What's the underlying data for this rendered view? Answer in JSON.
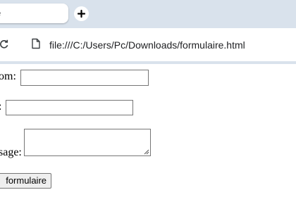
{
  "browser": {
    "tab": {
      "title": "e"
    },
    "new_tab_icon": "plus-icon",
    "reload_icon": "reload-icon",
    "page_icon": "file-icon",
    "address": "file:///C:/Users/Pc/Downloads/formulaire.html"
  },
  "form": {
    "fields": [
      {
        "label": "om:",
        "value": ""
      },
      {
        "label": ":",
        "value": ""
      }
    ],
    "message": {
      "label": "sage:",
      "value": ""
    },
    "submit_label": "formulaire"
  },
  "colors": {
    "tabstrip": "#d9e2ec",
    "field_border": "#767676",
    "button_bg": "#efefef"
  }
}
